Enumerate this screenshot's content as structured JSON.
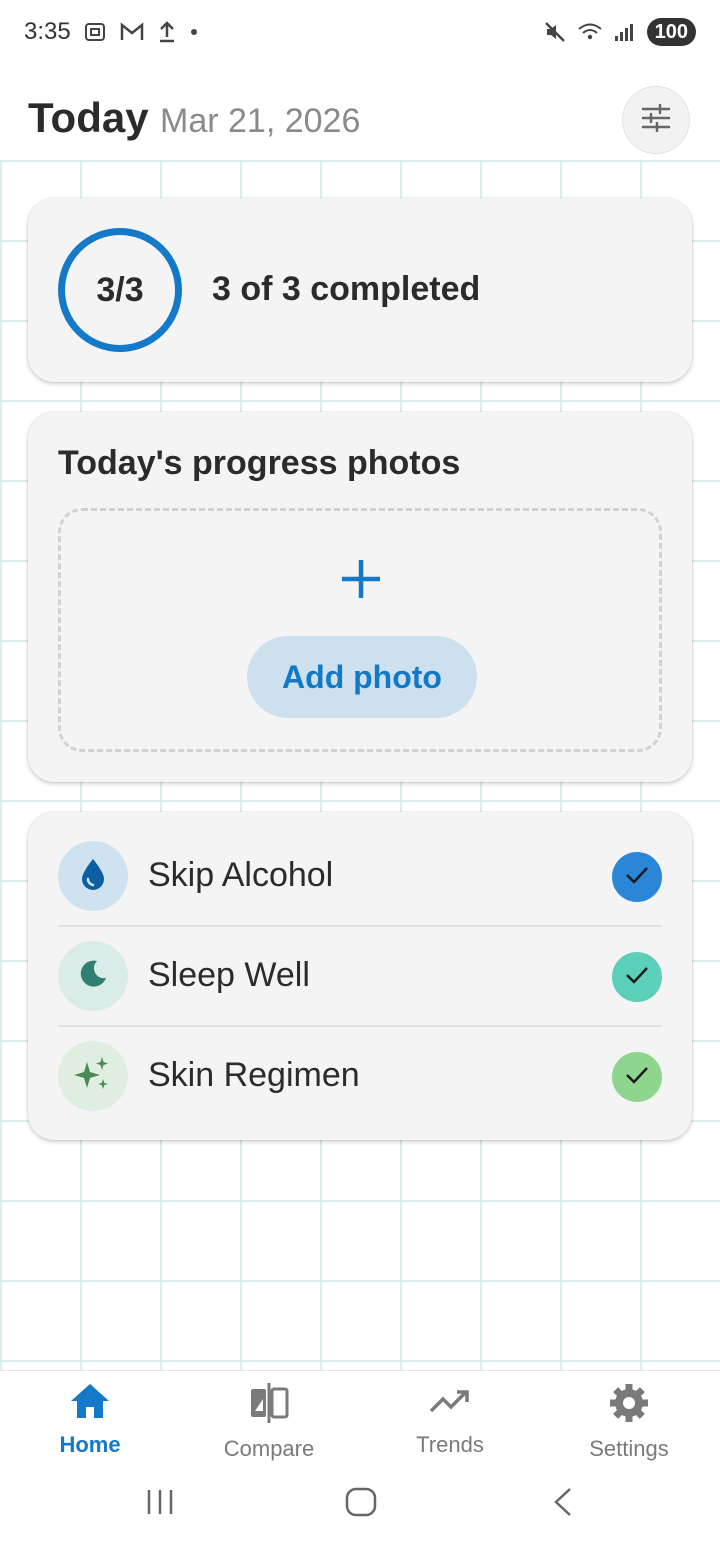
{
  "status_bar": {
    "time": "3:35",
    "battery": "100",
    "icons": [
      "screenshot-icon",
      "gmail-icon",
      "upload-icon",
      "dot-icon",
      "mute-icon",
      "wifi-icon",
      "signal-icon"
    ]
  },
  "header": {
    "title": "Today",
    "date": "Mar 21, 2026",
    "filter_icon": "sliders-icon"
  },
  "progress": {
    "ring_label": "3/3",
    "summary": "3 of 3 completed",
    "completed": 3,
    "total": 3
  },
  "photos": {
    "title": "Today's progress photos",
    "add_button": "Add photo"
  },
  "habits": [
    {
      "label": "Skip Alcohol",
      "icon": "drop-icon",
      "icon_color": "#0d5fa3",
      "icon_bg": "#cfe2f0",
      "check_color": "#2a86d6",
      "checked": true
    },
    {
      "label": "Sleep Well",
      "icon": "moon-icon",
      "icon_color": "#2f7f72",
      "icon_bg": "#d9ece8",
      "check_color": "#5ccfb8",
      "checked": true
    },
    {
      "label": "Skin Regimen",
      "icon": "sparkle-icon",
      "icon_color": "#4a8a56",
      "icon_bg": "#dfeee0",
      "check_color": "#8ed68e",
      "checked": true
    }
  ],
  "nav": {
    "items": [
      {
        "label": "Home",
        "icon": "home-icon",
        "active": true
      },
      {
        "label": "Compare",
        "icon": "compare-icon",
        "active": false
      },
      {
        "label": "Trends",
        "icon": "trending-icon",
        "active": false
      },
      {
        "label": "Settings",
        "icon": "gear-icon",
        "active": false
      }
    ]
  },
  "colors": {
    "accent": "#1479c9",
    "grid": "#d6eeee",
    "card": "#f4f4f4"
  }
}
